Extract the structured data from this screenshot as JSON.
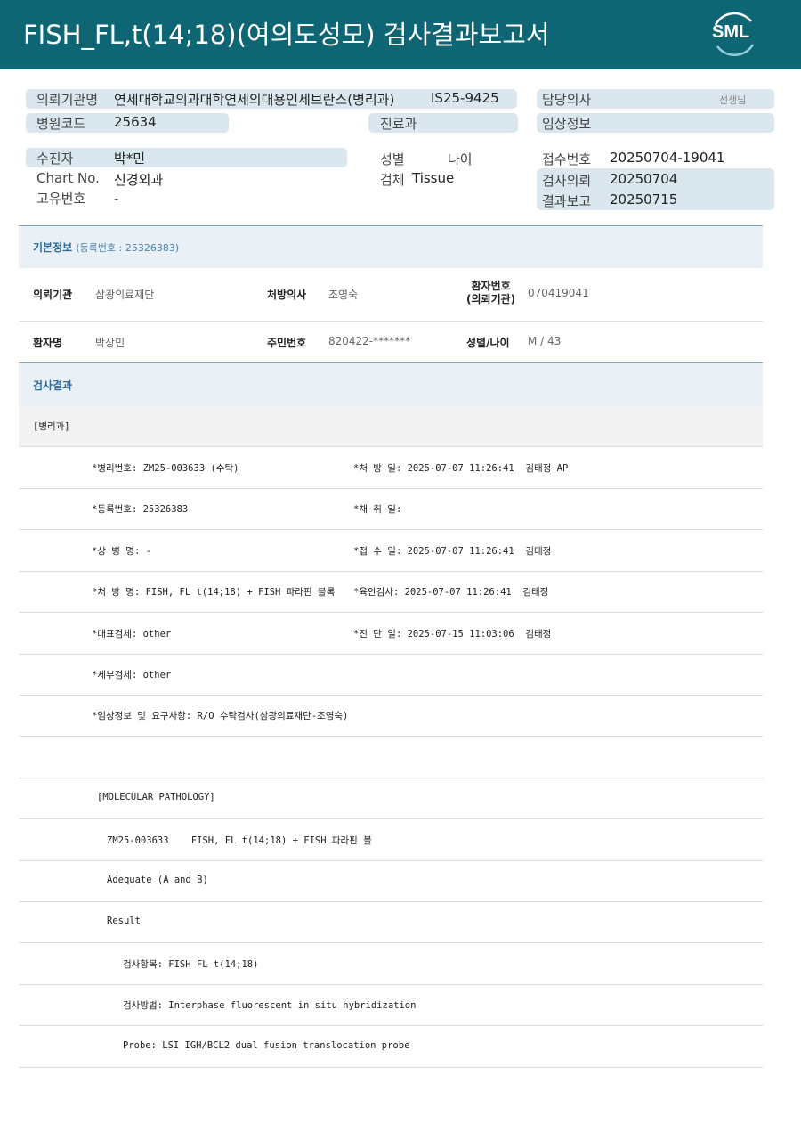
{
  "header": {
    "title": "FISH_FL,t(14;18)(여의도성모) 검사결과보고서",
    "logo_text": "SML",
    "accent": "#0e6573"
  },
  "report_header": {
    "requesting_institution_label": "의뢰기관명",
    "requesting_institution": "연세대학교의과대학연세의대용인세브란스(병리과)",
    "request_no": "IS25-9425",
    "doctor_label": "담당의사",
    "doctor_suffix": "선생님",
    "hospital_code_label": "병원코드",
    "hospital_code": "25634",
    "department_label": "진료과",
    "clinical_info_label": "임상정보",
    "patient_label": "수진자",
    "patient": "박*민",
    "sex_label": "성별",
    "age_label": "나이",
    "receipt_no_label": "접수번호",
    "receipt_no": "20250704-19041",
    "chart_label": "Chart No.",
    "chart_value": "신경외과",
    "specimen_label": "검체",
    "specimen": "Tissue",
    "test_request_label": "검사의뢰",
    "test_request": "20250704",
    "unique_no_label": "고유번호",
    "unique_no": "-",
    "result_report_label": "결과보고",
    "result_report": "20250715"
  },
  "basic_info": {
    "heading": "기본정보",
    "reg_no": "(등록번호 : 25326383)",
    "row1": {
      "inst_label": "의뢰기관",
      "inst": "삼광의료재단",
      "doctor_label": "처방의사",
      "doctor": "조영숙",
      "patient_no_label": "환자번호\n(의뢰기관)",
      "patient_no": "070419041"
    },
    "row2": {
      "name_label": "환자명",
      "name": "박상민",
      "rrn_label": "주민번호",
      "rrn": "820422-*******",
      "sex_age_label": "성별/나이",
      "sex_age": "M / 43"
    }
  },
  "results": {
    "heading": "검사결과",
    "dept": "[병리과]",
    "lines": [
      [
        "*병리번호: ZM25-003633 (수탁)",
        "*처 방 일: 2025-07-07 11:26:41  김태정 AP"
      ],
      [
        "*등록번호: 25326383",
        "*채 취 일:"
      ],
      [
        "*상 병 명: -",
        "*접 수 일: 2025-07-07 11:26:41  김태정"
      ],
      [
        "*처 방 명: FISH, FL t(14;18) + FISH 파라핀 블록",
        "*육안검사: 2025-07-07 11:26:41  김태정"
      ],
      [
        "*대표검체: other",
        "*진 단 일: 2025-07-15 11:03:06  김태정"
      ],
      [
        "*세부검체: other",
        ""
      ],
      [
        "*임상정보 및 요구사항: R/O 수탁검사(삼광의료재단-조영숙)",
        ""
      ],
      [
        "",
        ""
      ]
    ],
    "molecular": [
      "[MOLECULAR PATHOLOGY]",
      "ZM25-003633    FISH, FL t(14;18) + FISH 파라핀 블",
      "Adequate (A and B)",
      "Result",
      "검사항목: FISH FL t(14;18)",
      "검사방법: Interphase fluorescent in situ hybridization",
      "Probe: LSI IGH/BCL2 dual fusion translocation probe"
    ]
  }
}
